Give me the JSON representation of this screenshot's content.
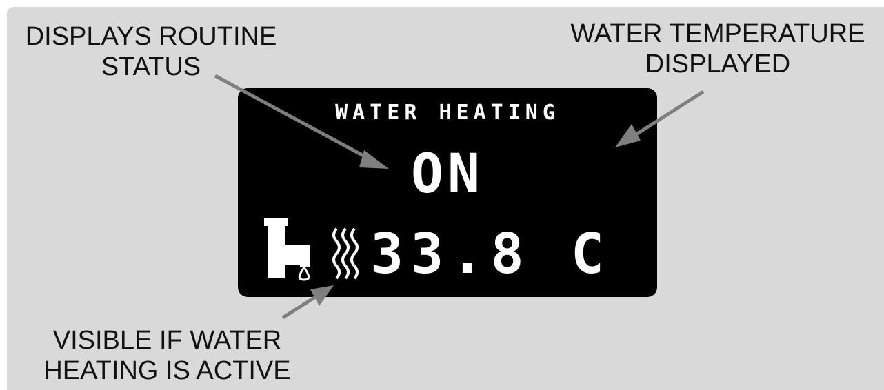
{
  "callouts": {
    "routine_status": [
      "DISPLAYS ROUTINE",
      "STATUS"
    ],
    "temperature": [
      "WATER TEMPERATURE",
      "DISPLAYED"
    ],
    "heating_icon": [
      "VISIBLE IF WATER",
      "HEATING IS ACTIVE"
    ]
  },
  "screen": {
    "title": "WATER HEATING",
    "status": "ON",
    "temperature": "33.8 C"
  },
  "icons": [
    "faucet-icon",
    "heat-waves-icon"
  ],
  "colors": {
    "background": "#d9d9d9",
    "screen": "#000000",
    "screen_text": "#ffffff",
    "arrow": "#7f7f7f",
    "label_text": "#111111"
  }
}
